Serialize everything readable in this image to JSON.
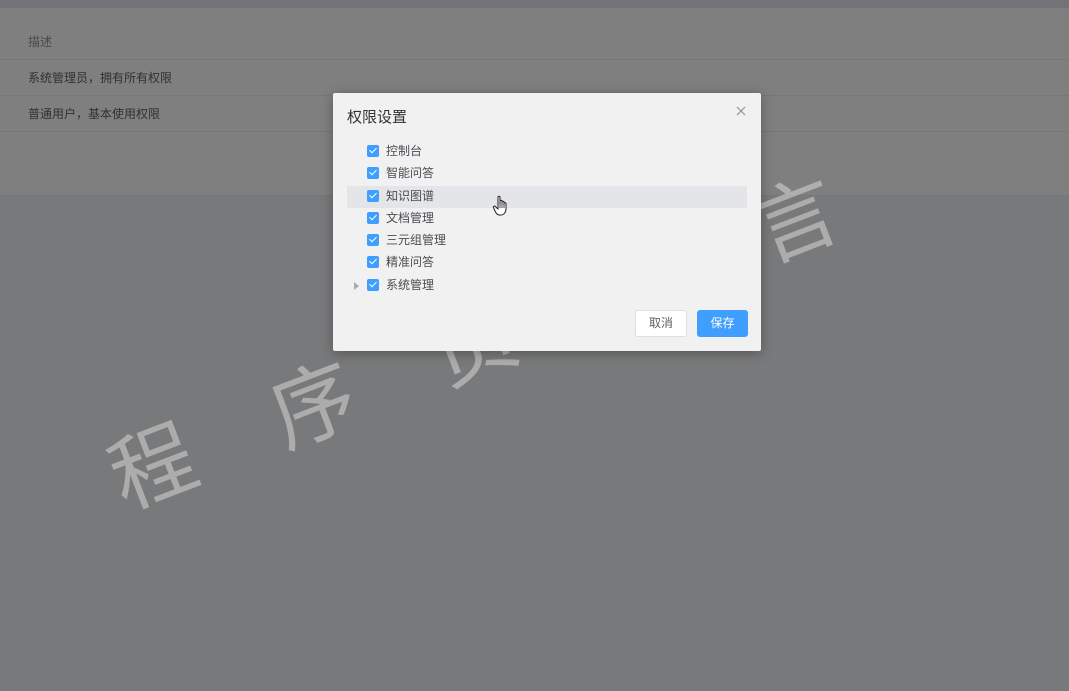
{
  "background_table": {
    "header": "描述",
    "rows": [
      "系统管理员，拥有所有权限",
      "普通用户，基本使用权限"
    ]
  },
  "watermark": {
    "text": "程序员无言"
  },
  "dialog": {
    "title": "权限设置",
    "close_icon": "close-icon",
    "tree": [
      {
        "label": "控制台",
        "checked": true,
        "has_children": false
      },
      {
        "label": "智能问答",
        "checked": true,
        "has_children": false
      },
      {
        "label": "知识图谱",
        "checked": true,
        "has_children": false,
        "hovered": true
      },
      {
        "label": "文档管理",
        "checked": true,
        "has_children": false
      },
      {
        "label": "三元组管理",
        "checked": true,
        "has_children": false
      },
      {
        "label": "精准问答",
        "checked": true,
        "has_children": false
      },
      {
        "label": "系统管理",
        "checked": true,
        "has_children": true,
        "expanded": false
      }
    ],
    "cancel_label": "取消",
    "save_label": "保存"
  },
  "colors": {
    "primary": "#409eff",
    "overlay": "rgba(0,0,0,0.5)"
  }
}
